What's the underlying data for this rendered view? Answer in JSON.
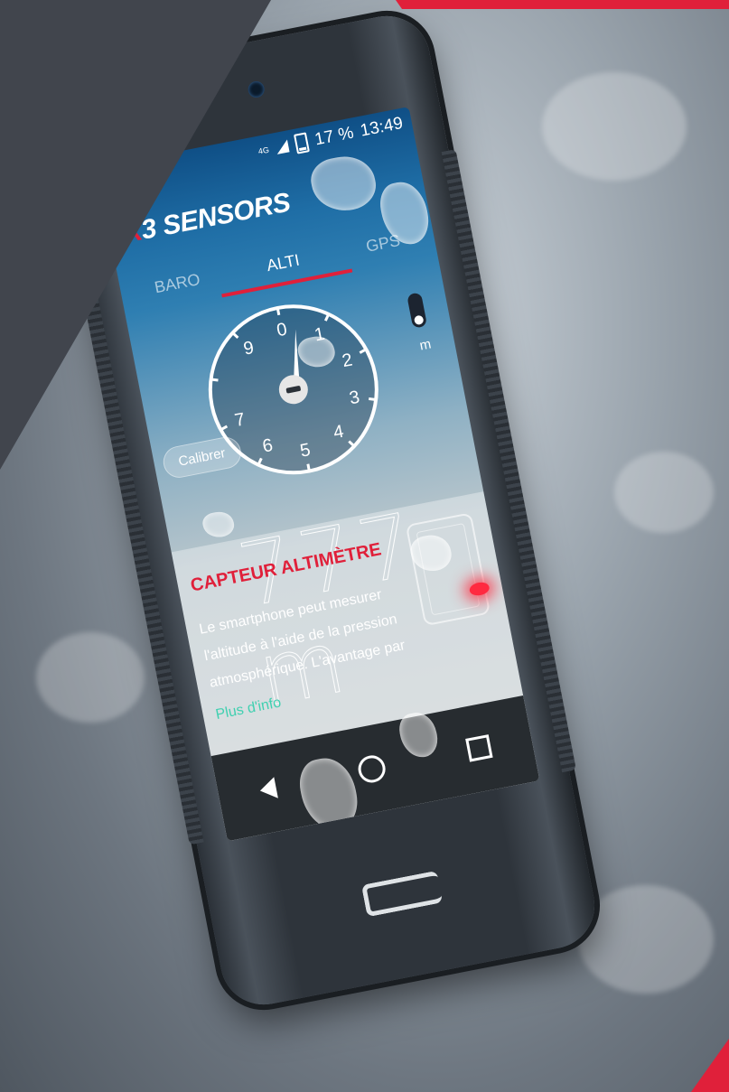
{
  "colors": {
    "accent_red": "#e0203a",
    "panel_dark": "#41454d",
    "link_teal": "#3fd0b0"
  },
  "status_bar": {
    "network": "4G",
    "battery": "17 %",
    "time": "13:49"
  },
  "app": {
    "brand_x": "X",
    "brand_rest": "3 SENSORS"
  },
  "tabs": [
    {
      "label": "BARO",
      "active": false
    },
    {
      "label": "ALTI",
      "active": true
    },
    {
      "label": "GPS",
      "active": false
    }
  ],
  "dial": {
    "ticks": [
      "0",
      "1",
      "2",
      "3",
      "4",
      "5",
      "6",
      "7",
      "9"
    ]
  },
  "controls": {
    "calibrate_label": "Calibrer",
    "unit": "m"
  },
  "reading": {
    "value": "777",
    "unit": "m"
  },
  "info": {
    "title": "CAPTEUR ALTIMÈTRE",
    "body": "Le smartphone peut mesurer l'altitude à l'aide de la pression atmosphérique. L'avantage par",
    "more": "Plus d'info"
  },
  "icons": {
    "back": "back-icon",
    "home": "home-icon",
    "recent": "recent-apps-icon"
  }
}
